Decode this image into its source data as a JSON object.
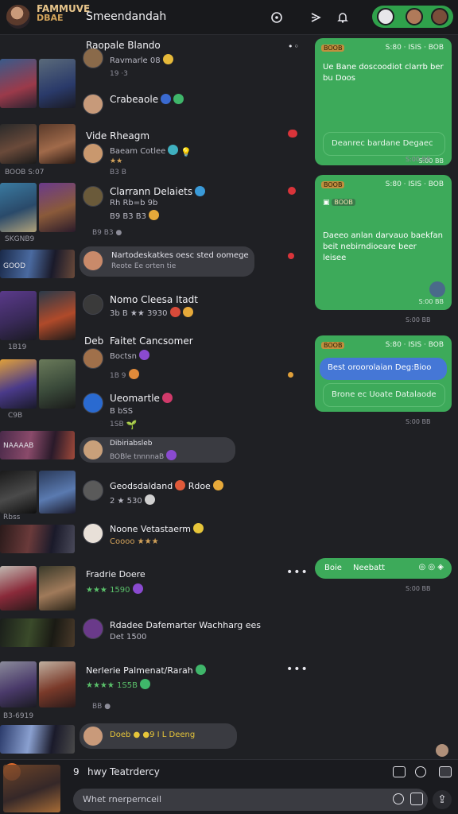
{
  "header": {
    "logo_line1": "FAMMUVE",
    "logo_line2": "DBAE",
    "title": "Smeendandah"
  },
  "rows": [
    {
      "name": "Raopale Blando",
      "sub": "Ravmarle 08",
      "meta": "19  ·3",
      "thumb_caption": ""
    },
    {
      "name": "Crabeaole",
      "sub": "",
      "meta": "",
      "thumb_caption": ""
    },
    {
      "name": "Vide Rheagm",
      "sub": "Baeam Cotlee",
      "meta": "★★",
      "thumb_caption": "BOOB  S:07"
    },
    {
      "name": "Clarrann Delaiets",
      "sub": "Rh Rb=b 9b",
      "meta": "B9  B3  ●",
      "thumb_caption": "SKGNB9"
    },
    {
      "name": "Nartodeskatkes oesc sted oomege",
      "sub": "Reote Ee orten tie",
      "meta": "",
      "thumb_caption": "GOOD"
    },
    {
      "name": "Nomo Cleesa Itadt",
      "sub": "3b B ★★ 3930",
      "meta": "",
      "thumb_caption": "1B19"
    },
    {
      "name": "Faitet Cancsomer",
      "sub": "Boctsn",
      "meta": "1B  9",
      "thumb_caption": "",
      "prefix": "Deb"
    },
    {
      "name": "Ueomartle",
      "sub": "B bSS",
      "meta": "1SB",
      "thumb_caption": "C9B"
    },
    {
      "name": "Dibiriabsleb",
      "sub": "BOBle tnnnnaB",
      "meta": "",
      "thumb_caption": "NAAAAB"
    },
    {
      "name": "Geodsdaldand",
      "sub": "2 ★ 530",
      "meta": "",
      "thumb_caption": "Rbss"
    },
    {
      "name": "Noone Vetastaerm",
      "sub": "Coooo ★★★",
      "meta": "",
      "thumb_caption": ""
    },
    {
      "name": "Fradrie Doere",
      "sub": "★★★ 1590",
      "meta": "",
      "thumb_caption": ""
    },
    {
      "name": "Rdadee Dafemarter Wachharg ees",
      "sub": "Det 1500",
      "meta": "",
      "thumb_caption": ""
    },
    {
      "name": "Nerlerie Palmenat/Rarah",
      "sub": "★★★★ 1S5B",
      "meta": "BB  ●",
      "thumb_caption": "B3-6919"
    },
    {
      "name": "Doeb  ●  ●9  I L Deeng",
      "sub": "",
      "meta": "",
      "thumb_caption": ""
    }
  ],
  "green_bubbles": [
    {
      "tag": "BOOB",
      "top_right": "S:80  ·  ISIS  ·  BOB",
      "body": "Ue Bane doscoodiot clarrb ber\nbu Doos",
      "inner": "Deanrec bardane Degaec",
      "time": "S:00  BB"
    },
    {
      "tag": "BOOB",
      "top_right": "S:80  ·  ISIS  ·  BOB",
      "chip": "BOOB",
      "body": "Daeeo anlan darvauo baekfan\nbeit nebirndioeare beer\nleisee",
      "time": "S:00  BB"
    },
    {
      "tag": "BOOB",
      "top_right": "S:80  ·  ISIS  ·  BOB",
      "blue": "Best oroorolaian Deg:Bioo",
      "inner": "Brone ec Uoate Datalaode",
      "time": "S:00  BB"
    },
    {
      "label1": "Boie",
      "label2": "Neebatt",
      "time": "S:00  BB"
    }
  ],
  "timestamps": [
    "S:00  BB",
    "S:00  BB",
    "S:00  BB",
    "S:00  BB",
    "S:00  BB"
  ],
  "bottom": {
    "count": "9",
    "label1": "hwy",
    "label2": "Teatrdercy",
    "input_placeholder": "Whet rnerpernceil"
  },
  "colors": {
    "accent_green": "#3daa5a",
    "accent_blue": "#4577d6",
    "background": "#1f2024",
    "badge_red": "#d9343a"
  }
}
